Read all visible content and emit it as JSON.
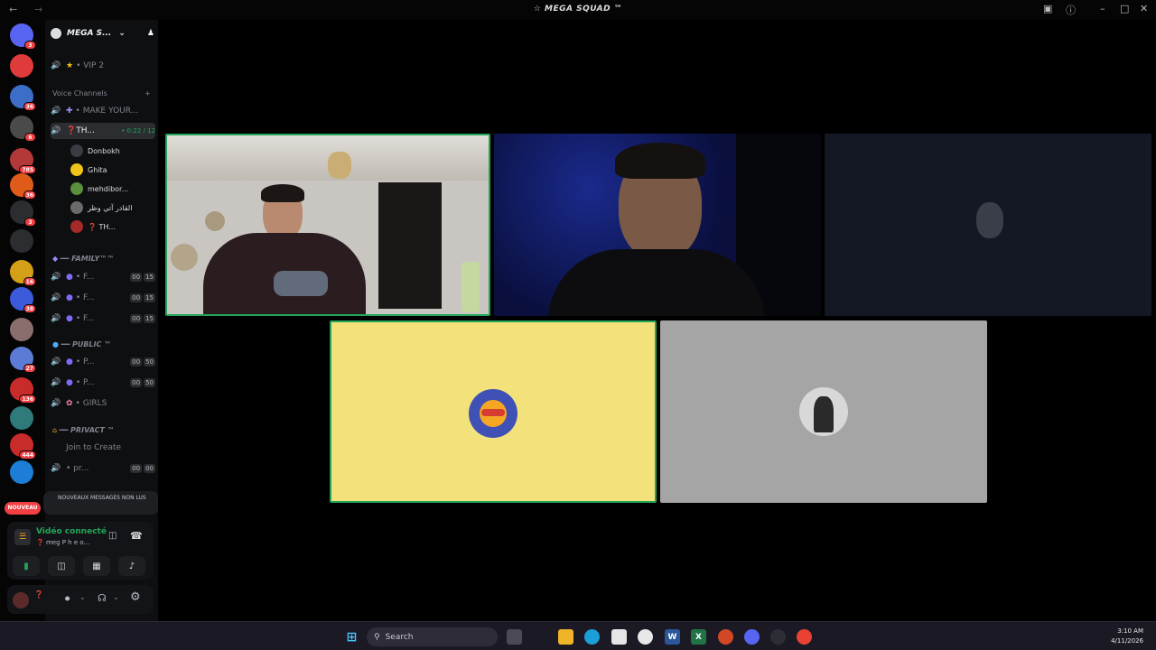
{
  "window": {
    "title": "☆ MEGA SQUAD ™",
    "back_glyph": "←",
    "forward_glyph": "→"
  },
  "server": {
    "name": "MEGA S...",
    "dropdown_glyph": "⌄"
  },
  "channels": {
    "vip2": "• VIP 2",
    "voice_category": "Voice Channels",
    "make_your": "• MAKE YOUR...",
    "active_channel": "❓TH...",
    "active_channel_count": "• 0:22 / 12",
    "users": [
      {
        "name": "Donbokh",
        "color": "#3a3c43"
      },
      {
        "name": "Ghita",
        "color": "#f0c419"
      },
      {
        "name": "mehdibor...",
        "color": "#5a8f3c"
      },
      {
        "name": "القادر آتي وظر",
        "color": "#6b6b6b"
      },
      {
        "name": "❓ TH...",
        "color": "#a62a2a"
      }
    ],
    "family_category": "━━ FAMILY™™",
    "family_channels": [
      {
        "name": "• F...",
        "a": "00",
        "b": "15"
      },
      {
        "name": "• F...",
        "a": "00",
        "b": "15"
      },
      {
        "name": "• F...",
        "a": "00",
        "b": "15"
      }
    ],
    "public_category": "━━ PUBLIC ™",
    "public_channels": [
      {
        "name": "• P...",
        "a": "00",
        "b": "50"
      },
      {
        "name": "• P...",
        "a": "00",
        "b": "50"
      }
    ],
    "girls": "• GIRLS",
    "private_category": "━━ PRIVACT ™",
    "join_to_create": "Join to Create",
    "private_channel": {
      "name": "• pr...",
      "a": "00",
      "b": "00"
    }
  },
  "toast": {
    "text": "NOUVEAUX MESSAGES NON LUS",
    "pill": "NOUVEAU"
  },
  "voice": {
    "status": "Vidéo connecté",
    "server": "❓ meɡ P h e o..."
  },
  "guilds": [
    {
      "badge": "3",
      "color": "#5865f2"
    },
    {
      "badge": "",
      "color": "#e03b3b"
    },
    {
      "badge": "36",
      "color": "#3c6ec8"
    },
    {
      "badge": "6",
      "color": "#4a4a4a"
    },
    {
      "badge": "785",
      "color": "#b33939"
    },
    {
      "badge": "36",
      "color": "#e05a1a"
    },
    {
      "badge": "3",
      "color": "#2b2d31"
    },
    {
      "badge": "",
      "color": "#2b2d31"
    },
    {
      "badge": "16",
      "color": "#d4a017"
    },
    {
      "badge": "38",
      "color": "#3b5bdb"
    },
    {
      "badge": "",
      "color": "#8a6d6d"
    },
    {
      "badge": "27",
      "color": "#5b7bd5"
    },
    {
      "badge": "136",
      "color": "#c92a2a"
    },
    {
      "badge": "",
      "color": "#2f7a7a"
    },
    {
      "badge": "444",
      "color": "#c92a2a"
    },
    {
      "badge": "",
      "color": "#1c7ed6"
    }
  ],
  "taskbar": {
    "search_placeholder": "Search",
    "time": "3:10 AM",
    "date": "4/11/2026"
  }
}
